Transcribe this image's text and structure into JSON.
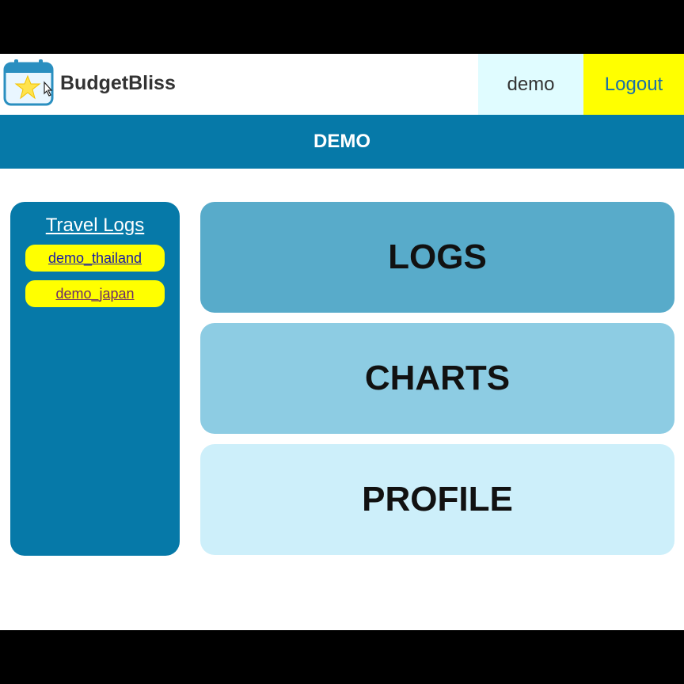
{
  "header": {
    "brand": "BudgetBliss",
    "user": "demo",
    "logout_label": "Logout"
  },
  "banner": {
    "title": "DEMO"
  },
  "sidebar": {
    "title": "Travel Logs",
    "logs": [
      {
        "label": "demo_thailand"
      },
      {
        "label": "demo_japan"
      }
    ]
  },
  "main": {
    "cards": [
      {
        "label": "LOGS"
      },
      {
        "label": "CHARTS"
      },
      {
        "label": "PROFILE"
      }
    ]
  },
  "colors": {
    "primary": "#0679a8",
    "accent_yellow": "#ffff00",
    "user_tab_bg": "#e0fcff",
    "logs_card": "#58abca",
    "charts_card": "#8dcce3",
    "profile_card": "#cdeffa"
  },
  "icons": {
    "logo": "calendar-star-icon"
  }
}
